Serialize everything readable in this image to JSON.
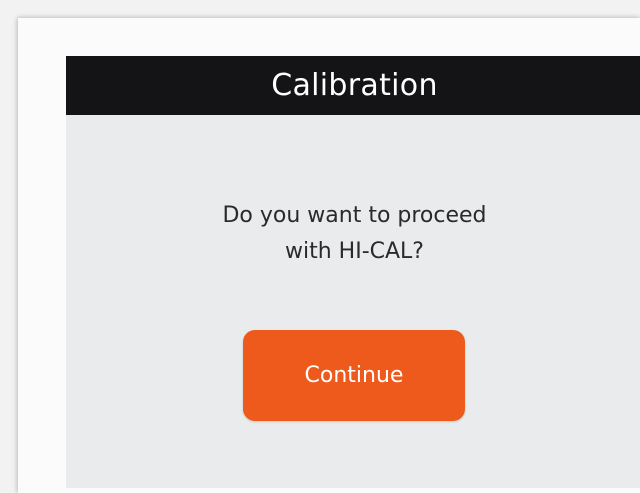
{
  "dialog": {
    "title": "Calibration",
    "message_line1": "Do you want to proceed",
    "message_line2": "with HI-CAL?",
    "continue_label": "Continue"
  },
  "colors": {
    "titlebar": "#141416",
    "screen_background": "#eaebed",
    "accent_button": "#ee5a1b"
  }
}
